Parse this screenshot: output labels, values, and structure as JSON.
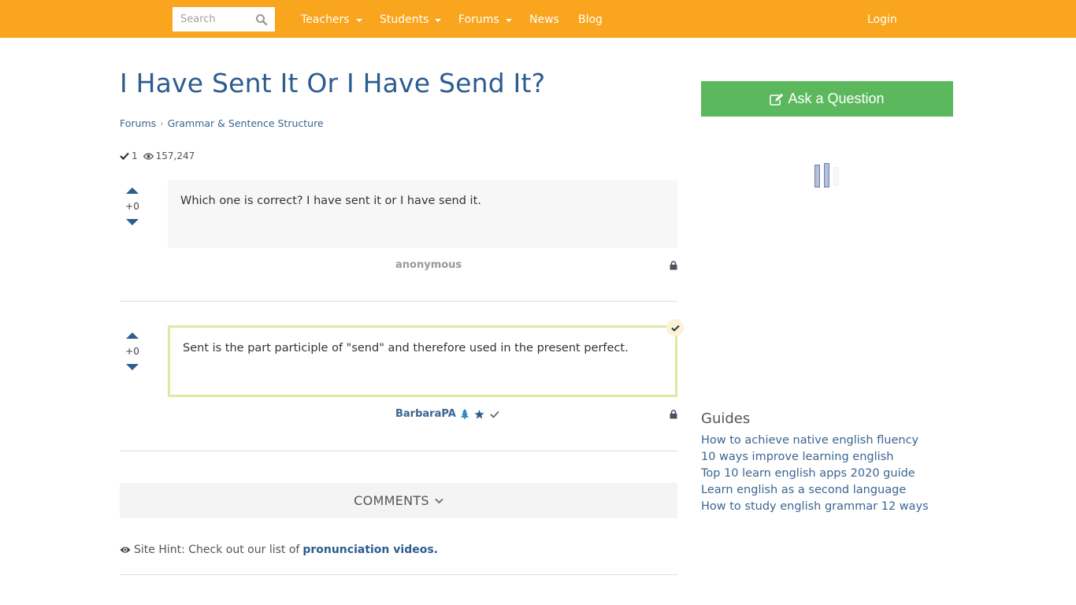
{
  "navbar": {
    "search_placeholder": "Search",
    "items": [
      {
        "label": "Teachers",
        "has_dropdown": true
      },
      {
        "label": "Students",
        "has_dropdown": true
      },
      {
        "label": "Forums",
        "has_dropdown": true
      },
      {
        "label": "News",
        "has_dropdown": false
      },
      {
        "label": "Blog",
        "has_dropdown": false
      }
    ],
    "login_label": "Login",
    "background_color": "#f9a51d"
  },
  "page": {
    "title": "I Have Sent It Or I Have Send It?",
    "breadcrumb": [
      "Forums",
      "Grammar & Sentence Structure"
    ],
    "answers_count": "1",
    "views_count": "157,247"
  },
  "question": {
    "votes": "+0",
    "body": "Which one is correct? I have sent it or I have send it.",
    "author": "anonymous"
  },
  "answer": {
    "votes": "+0",
    "body": "Sent is the part participle of \"send\" and therefore used in the present perfect.",
    "author": "BarbaraPA",
    "accepted": true,
    "author_badges": [
      "tree-icon",
      "star-icon",
      "check-icon"
    ]
  },
  "comments": {
    "label": "COMMENTS"
  },
  "site_hint": {
    "text": "Site Hint: Check out our list of",
    "link_label": "pronunciation videos."
  },
  "sidebar": {
    "ask_button_label": "Ask a Question",
    "ask_button_color": "#5cb85c",
    "guides_title": "Guides",
    "guides": [
      "How to achieve native english fluency",
      "10 ways improve learning english",
      "Top 10 learn english apps 2020 guide",
      "Learn english as a second language",
      "How to study english grammar 12 ways"
    ]
  }
}
